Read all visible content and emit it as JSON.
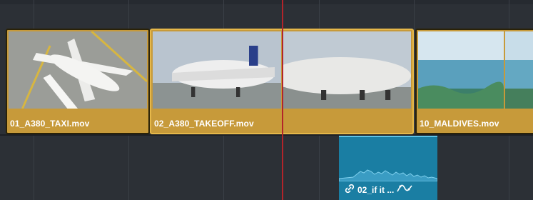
{
  "timeline": {
    "video_clips": [
      {
        "name": "01_A380_TAXI.mov"
      },
      {
        "name": "02_A380_TAKEOFF.mov"
      },
      {
        "name": ""
      },
      {
        "name": "10_MALDIVES.mov"
      }
    ],
    "audio_clip": {
      "name": "02_if it ..."
    }
  },
  "colors": {
    "background": "#2c3036",
    "video_clip": "#c79a3a",
    "audio_clip": "#1a7ea3",
    "playhead": "#b3242a"
  },
  "icons": {
    "link": "link-icon",
    "curve": "volume-curve-icon"
  }
}
